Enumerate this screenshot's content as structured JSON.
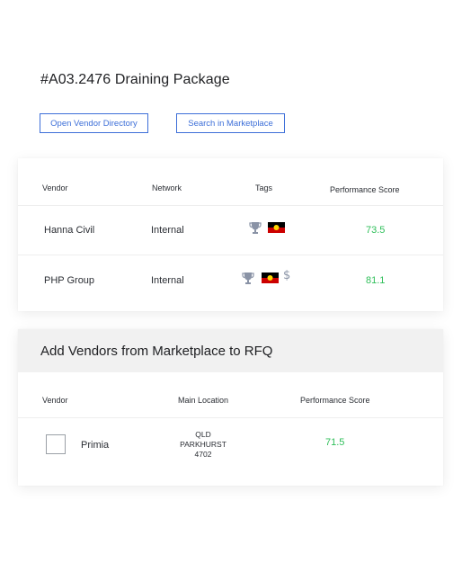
{
  "page": {
    "title": "#A03.2476 Draining Package"
  },
  "actions": {
    "open_vendor_directory": "Open Vendor Directory",
    "search_marketplace": "Search in Marketplace"
  },
  "vendor_table": {
    "columns": [
      "Vendor",
      "Network",
      "Tags",
      "Performance Score"
    ],
    "rows": [
      {
        "vendor": "Hanna Civil",
        "network": "Internal",
        "tags": [
          "trophy-icon",
          "aboriginal-flag-icon"
        ],
        "score": "73.5"
      },
      {
        "vendor": "PHP Group",
        "network": "Internal",
        "tags": [
          "trophy-icon",
          "aboriginal-flag-icon",
          "dollar-icon"
        ],
        "score": "81.1"
      }
    ]
  },
  "marketplace": {
    "title": "Add Vendors from Marketplace to RFQ",
    "columns": [
      "Vendor",
      "Main Location",
      "Performance Score"
    ],
    "rows": [
      {
        "vendor": "Primia",
        "location": [
          "QLD",
          "PARKHURST",
          "4702"
        ],
        "score": "71.5",
        "selected": false
      }
    ]
  },
  "icons": {
    "dollar_glyph": "$"
  },
  "colors": {
    "accent": "#3d6fd8",
    "score": "#2fbf5a",
    "icon_gray": "#8a93a6",
    "flag_black": "#000000",
    "flag_red": "#cc0000",
    "flag_yellow": "#ffd700"
  }
}
